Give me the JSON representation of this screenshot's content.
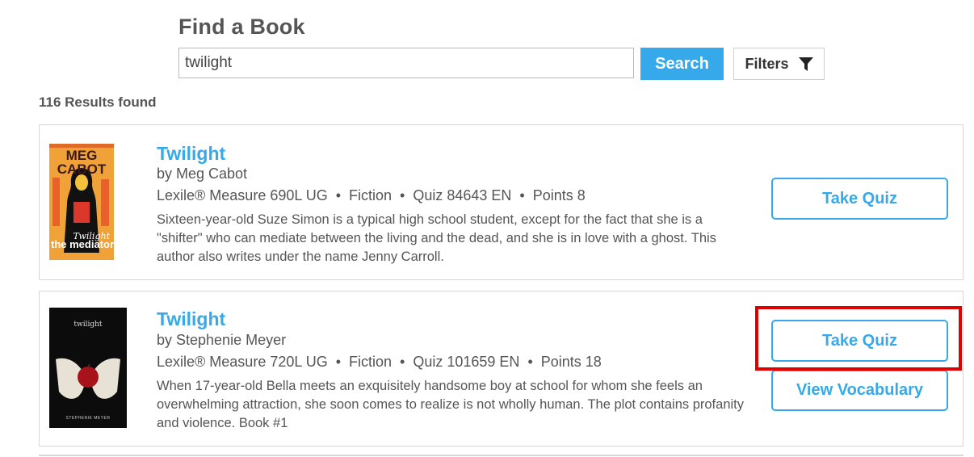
{
  "header": {
    "title": "Find a Book"
  },
  "search": {
    "value": "twilight",
    "button_label": "Search",
    "filters_label": "Filters"
  },
  "results": {
    "count_text": "116 Results found"
  },
  "books": [
    {
      "title": "Twilight",
      "author": "by Meg Cabot",
      "lexile": "Lexile® Measure 690L UG",
      "genre": "Fiction",
      "quiz": "Quiz 84643 EN",
      "points": "Points 8",
      "description": "Sixteen-year-old Suze Simon is a typical high school student, except for the fact that she is a \"shifter\" who can mediate between the living and the dead, and she is in love with a ghost. This author also writes under the name Jenny Carroll.",
      "cover": {
        "line1": "MEG",
        "line2": "CABOT",
        "subtitle": "Twilight",
        "series": "the mediator"
      },
      "take_quiz_label": "Take Quiz"
    },
    {
      "title": "Twilight",
      "author": "by Stephenie Meyer",
      "lexile": "Lexile® Measure 720L UG",
      "genre": "Fiction",
      "quiz": "Quiz 101659 EN",
      "points": "Points 18",
      "description": "When 17-year-old Bella meets an exquisitely handsome boy at school for whom she feels an overwhelming attraction, she soon comes to realize is not wholly human. The plot contains profanity and violence. Book #1",
      "cover": {
        "title": "twilight",
        "author": "STEPHENIE MEYER"
      },
      "take_quiz_label": "Take Quiz",
      "view_vocab_label": "View Vocabulary"
    }
  ],
  "separator": "•",
  "colors": {
    "accent": "#35a9e9",
    "highlight": "#e00000",
    "text": "#555555"
  }
}
